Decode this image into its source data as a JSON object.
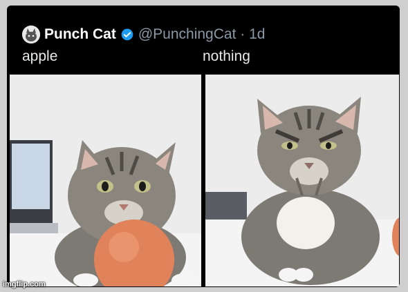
{
  "tweet": {
    "display_name": "Punch Cat",
    "verified_icon": "verified-badge-icon",
    "handle_time": "@PunchingCat · 1d",
    "left_caption": "apple",
    "right_caption": "nothing"
  },
  "watermark": "imgflip.com",
  "colors": {
    "card_bg": "#000000",
    "verified_blue": "#1d9bf0",
    "handle_gray": "#8b98a5"
  }
}
